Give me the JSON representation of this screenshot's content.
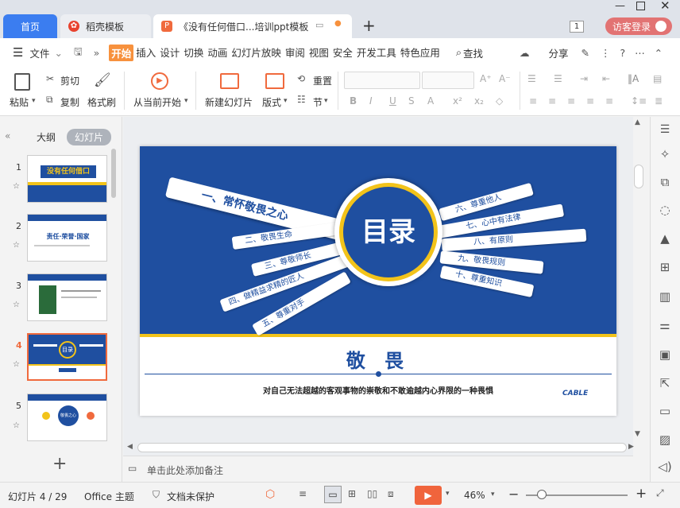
{
  "tabs": {
    "home": "首页",
    "daoke": "稻壳模板",
    "doc": "《没有任何借口...培训ppt模板",
    "add": "+",
    "badge": "1",
    "login": "访客登录"
  },
  "menu": {
    "file": "文件",
    "items": [
      "开始",
      "插入",
      "设计",
      "切换",
      "动画",
      "幻灯片放映",
      "审阅",
      "视图",
      "安全",
      "开发工具",
      "特色应用"
    ],
    "search": "查找",
    "share": "分享"
  },
  "ribbon": {
    "paste": "粘贴",
    "cut": "剪切",
    "copy": "复制",
    "format_painter": "格式刷",
    "from_current": "从当前开始",
    "new_slide": "新建幻灯片",
    "layout": "版式",
    "reset": "重置",
    "section": "节"
  },
  "left_panel": {
    "outline": "大纲",
    "slides": "幻灯片",
    "add": "+",
    "slide_numbers": [
      "1",
      "2",
      "3",
      "4",
      "5"
    ],
    "thumb1_title": "没有任何借口",
    "thumb2_title": "责任·荣誉·国家",
    "thumb4_title": "目录",
    "thumb5_title": "敬畏之心"
  },
  "slide": {
    "center_title": "目录",
    "left_items": [
      "一、常怀敬畏之心",
      "二、敬畏生命",
      "三、尊敬师长",
      "四、做精益求精的匠人",
      "五、尊重对手"
    ],
    "right_items": [
      "六、尊重他人",
      "七、心中有法律",
      "八、有原则",
      "九、敬畏规则",
      "十、尊重知识"
    ],
    "section_title": "敬 畏",
    "subtitle": "对自己无法超越的客观事物的崇敬和不敢逾越内心界限的一种畏惧",
    "logo_text": "CABLE"
  },
  "notes_placeholder": "单击此处添加备注",
  "status": {
    "slide_count": "幻灯片 4 / 29",
    "theme": "Office 主题",
    "protect": "文档未保护",
    "zoom": "46%"
  },
  "colors": {
    "slide_blue": "#1f4fa0",
    "accent_gold": "#f2c31a",
    "tab_blue": "#3b7df0",
    "active_orange": "#f7913d",
    "play_red": "#f0643c"
  }
}
